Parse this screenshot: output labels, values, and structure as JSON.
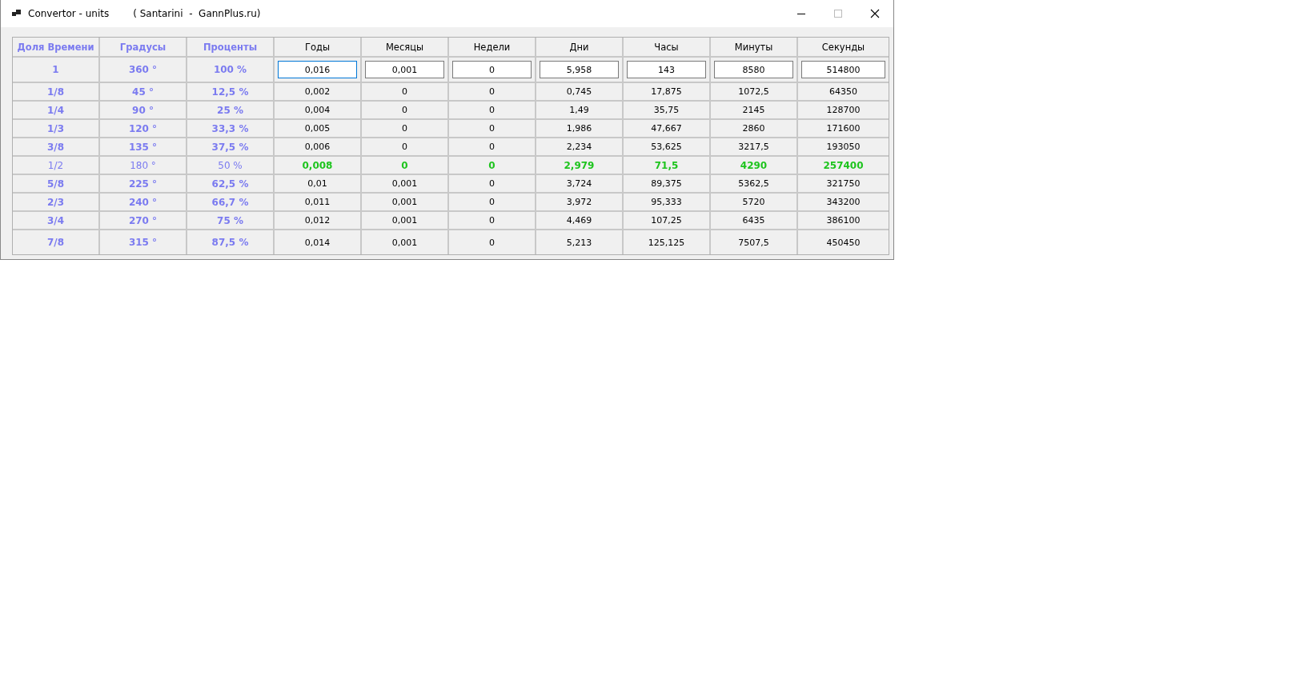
{
  "window": {
    "title": "Convertor - units",
    "subtitle": "( Santarini  -  GannPlus.ru)"
  },
  "table": {
    "columns": [
      {
        "label": "Доля Времени",
        "kind": "key"
      },
      {
        "label": "Градусы",
        "kind": "key"
      },
      {
        "label": "Проценты",
        "kind": "key"
      },
      {
        "label": "Годы",
        "kind": "unit"
      },
      {
        "label": "Месяцы",
        "kind": "unit"
      },
      {
        "label": "Недели",
        "kind": "unit"
      },
      {
        "label": "Дни",
        "kind": "unit"
      },
      {
        "label": "Часы",
        "kind": "unit"
      },
      {
        "label": "Минуты",
        "kind": "unit"
      },
      {
        "label": "Секунды",
        "kind": "unit"
      }
    ],
    "rows": [
      {
        "kind": "input",
        "highlighted": false,
        "keys": [
          "1",
          "360 °",
          "100 %"
        ],
        "values": [
          {
            "value": "0,016",
            "focused": true
          },
          {
            "value": "0,001",
            "focused": false
          },
          {
            "value": "0",
            "focused": false
          },
          {
            "value": "5,958",
            "focused": false
          },
          {
            "value": "143",
            "focused": false
          },
          {
            "value": "8580",
            "focused": false
          },
          {
            "value": "514800",
            "focused": false
          }
        ]
      },
      {
        "kind": "data",
        "highlighted": false,
        "keys": [
          "1/8",
          "45 °",
          "12,5 %"
        ],
        "values": [
          "0,002",
          "0",
          "0",
          "0,745",
          "17,875",
          "1072,5",
          "64350"
        ]
      },
      {
        "kind": "data",
        "highlighted": false,
        "keys": [
          "1/4",
          "90 °",
          "25 %"
        ],
        "values": [
          "0,004",
          "0",
          "0",
          "1,49",
          "35,75",
          "2145",
          "128700"
        ]
      },
      {
        "kind": "data",
        "highlighted": false,
        "keys": [
          "1/3",
          "120 °",
          "33,3 %"
        ],
        "values": [
          "0,005",
          "0",
          "0",
          "1,986",
          "47,667",
          "2860",
          "171600"
        ]
      },
      {
        "kind": "data",
        "highlighted": false,
        "keys": [
          "3/8",
          "135 °",
          "37,5 %"
        ],
        "values": [
          "0,006",
          "0",
          "0",
          "2,234",
          "53,625",
          "3217,5",
          "193050"
        ]
      },
      {
        "kind": "data",
        "highlighted": true,
        "keys": [
          "1/2",
          "180 °",
          "50 %"
        ],
        "values": [
          "0,008",
          "0",
          "0",
          "2,979",
          "71,5",
          "4290",
          "257400"
        ]
      },
      {
        "kind": "data",
        "highlighted": false,
        "keys": [
          "5/8",
          "225 °",
          "62,5 %"
        ],
        "values": [
          "0,01",
          "0,001",
          "0",
          "3,724",
          "89,375",
          "5362,5",
          "321750"
        ]
      },
      {
        "kind": "data",
        "highlighted": false,
        "keys": [
          "2/3",
          "240 °",
          "66,7 %"
        ],
        "values": [
          "0,011",
          "0,001",
          "0",
          "3,972",
          "95,333",
          "5720",
          "343200"
        ]
      },
      {
        "kind": "data",
        "highlighted": false,
        "keys": [
          "3/4",
          "270 °",
          "75 %"
        ],
        "values": [
          "0,012",
          "0,001",
          "0",
          "4,469",
          "107,25",
          "6435",
          "386100"
        ]
      },
      {
        "kind": "data",
        "highlighted": false,
        "keys": [
          "7/8",
          "315 °",
          "87,5 %"
        ],
        "values": [
          "0,014",
          "0,001",
          "0",
          "5,213",
          "125,125",
          "7507,5",
          "450450"
        ]
      }
    ]
  }
}
